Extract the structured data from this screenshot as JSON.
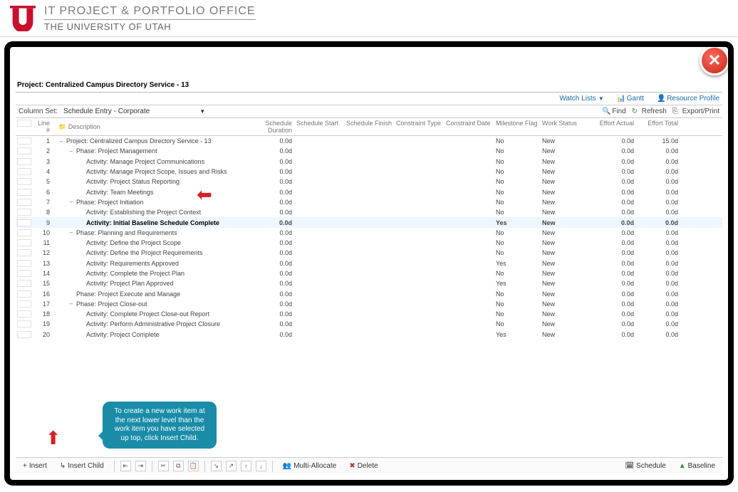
{
  "header": {
    "title_top": "IT PROJECT & PORTFOLIO OFFICE",
    "title_bot": "THE UNIVERSITY OF UTAH"
  },
  "project_title": "Project: Centralized Campus Directory Service - 13",
  "toplinks": {
    "watchlists": "Watch Lists",
    "gantt": "Gantt",
    "resource_profile": "Resource Profile"
  },
  "toolbar": {
    "column_set_label": "Column Set:",
    "column_set_value": "Schedule Entry - Corporate",
    "find": "Find",
    "refresh": "Refresh",
    "export": "Export/Print"
  },
  "columns": {
    "line": "Line #",
    "desc": "Description",
    "dur": "Schedule Duration",
    "start": "Schedule Start",
    "finish": "Schedule Finish",
    "ctype": "Constraint Type",
    "cdate": "Constraint Date",
    "mflag": "Milestone Flag",
    "wstat": "Work Status",
    "eact": "Effort Actual",
    "etot": "Effort Total"
  },
  "rows": [
    {
      "n": "1",
      "indent": 0,
      "toggle": "–",
      "desc": "Project: Centralized Campus Directory Service - 13",
      "dur": "0.0d",
      "mflag": "No",
      "wstat": "New",
      "eact": "0.0d",
      "etot": "15.0d"
    },
    {
      "n": "2",
      "indent": 1,
      "toggle": "–",
      "desc": "Phase: Project Management",
      "dur": "0.0d",
      "mflag": "No",
      "wstat": "New",
      "eact": "0.0d",
      "etot": "0.0d"
    },
    {
      "n": "3",
      "indent": 2,
      "toggle": "",
      "desc": "Activity: Manage Project Communications",
      "dur": "0.0d",
      "mflag": "No",
      "wstat": "New",
      "eact": "0.0d",
      "etot": "0.0d"
    },
    {
      "n": "4",
      "indent": 2,
      "toggle": "",
      "desc": "Activity: Manage Project Scope, Issues and Risks",
      "dur": "0.0d",
      "mflag": "No",
      "wstat": "New",
      "eact": "0.0d",
      "etot": "0.0d"
    },
    {
      "n": "5",
      "indent": 2,
      "toggle": "",
      "desc": "Activity: Project Status Reporting",
      "dur": "0.0d",
      "mflag": "No",
      "wstat": "New",
      "eact": "0.0d",
      "etot": "0.0d"
    },
    {
      "n": "6",
      "indent": 2,
      "toggle": "",
      "desc": "Activity: Team Meetings",
      "dur": "0.0d",
      "mflag": "No",
      "wstat": "New",
      "eact": "0.0d",
      "etot": "0.0d"
    },
    {
      "n": "7",
      "indent": 1,
      "toggle": "–",
      "desc": "Phase: Project Initiation",
      "dur": "0.0d",
      "mflag": "No",
      "wstat": "New",
      "eact": "0.0d",
      "etot": "0.0d"
    },
    {
      "n": "8",
      "indent": 2,
      "toggle": "",
      "desc": "Activity: Establishing the Project Context",
      "dur": "0.0d",
      "mflag": "No",
      "wstat": "New",
      "eact": "0.0d",
      "etot": "0.0d"
    },
    {
      "n": "9",
      "indent": 2,
      "toggle": "",
      "desc": "Activity: Initial Baseline Schedule Complete",
      "dur": "0.0d",
      "mflag": "Yes",
      "wstat": "New",
      "eact": "0.0d",
      "etot": "0.0d",
      "sel": true
    },
    {
      "n": "10",
      "indent": 1,
      "toggle": "–",
      "desc": "Phase: Planning and Requirements",
      "dur": "0.0d",
      "mflag": "No",
      "wstat": "New",
      "eact": "0.0d",
      "etot": "0.0d"
    },
    {
      "n": "11",
      "indent": 2,
      "toggle": "",
      "desc": "Activity: Define the Project Scope",
      "dur": "0.0d",
      "mflag": "No",
      "wstat": "New",
      "eact": "0.0d",
      "etot": "0.0d"
    },
    {
      "n": "12",
      "indent": 2,
      "toggle": "",
      "desc": "Activity: Define the Project Requirements",
      "dur": "0.0d",
      "mflag": "No",
      "wstat": "New",
      "eact": "0.0d",
      "etot": "0.0d"
    },
    {
      "n": "13",
      "indent": 2,
      "toggle": "",
      "desc": "Activity: Requirements Approved",
      "dur": "0.0d",
      "mflag": "Yes",
      "wstat": "New",
      "eact": "0.0d",
      "etot": "0.0d"
    },
    {
      "n": "14",
      "indent": 2,
      "toggle": "",
      "desc": "Activity: Complete the Project Plan",
      "dur": "0.0d",
      "mflag": "No",
      "wstat": "New",
      "eact": "0.0d",
      "etot": "0.0d"
    },
    {
      "n": "15",
      "indent": 2,
      "toggle": "",
      "desc": "Activity: Project Plan Approved",
      "dur": "0.0d",
      "mflag": "Yes",
      "wstat": "New",
      "eact": "0.0d",
      "etot": "0.0d"
    },
    {
      "n": "16",
      "indent": 1,
      "toggle": "",
      "desc": "Phase: Project Execute and Manage",
      "dur": "0.0d",
      "mflag": "No",
      "wstat": "New",
      "eact": "0.0d",
      "etot": "0.0d"
    },
    {
      "n": "17",
      "indent": 1,
      "toggle": "–",
      "desc": "Phase: Project Close-out",
      "dur": "0.0d",
      "mflag": "No",
      "wstat": "New",
      "eact": "0.0d",
      "etot": "0.0d"
    },
    {
      "n": "18",
      "indent": 2,
      "toggle": "",
      "desc": "Activity: Complete Project Close-out Report",
      "dur": "0.0d",
      "mflag": "No",
      "wstat": "New",
      "eact": "0.0d",
      "etot": "0.0d"
    },
    {
      "n": "19",
      "indent": 2,
      "toggle": "",
      "desc": "Activity: Perform Administrative Project Closure",
      "dur": "0.0d",
      "mflag": "No",
      "wstat": "New",
      "eact": "0.0d",
      "etot": "0.0d"
    },
    {
      "n": "20",
      "indent": 2,
      "toggle": "",
      "desc": "Activity: Project Complete",
      "dur": "0.0d",
      "mflag": "Yes",
      "wstat": "New",
      "eact": "0.0d",
      "etot": "0.0d"
    }
  ],
  "callout": "To create a new work item at the next lower level than the work item you have selected up top, click Insert Child.",
  "bottombar": {
    "insert": "Insert",
    "insert_child": "Insert Child",
    "multi_allocate": "Multi-Allocate",
    "delete": "Delete",
    "schedule": "Schedule",
    "baseline": "Baseline"
  }
}
